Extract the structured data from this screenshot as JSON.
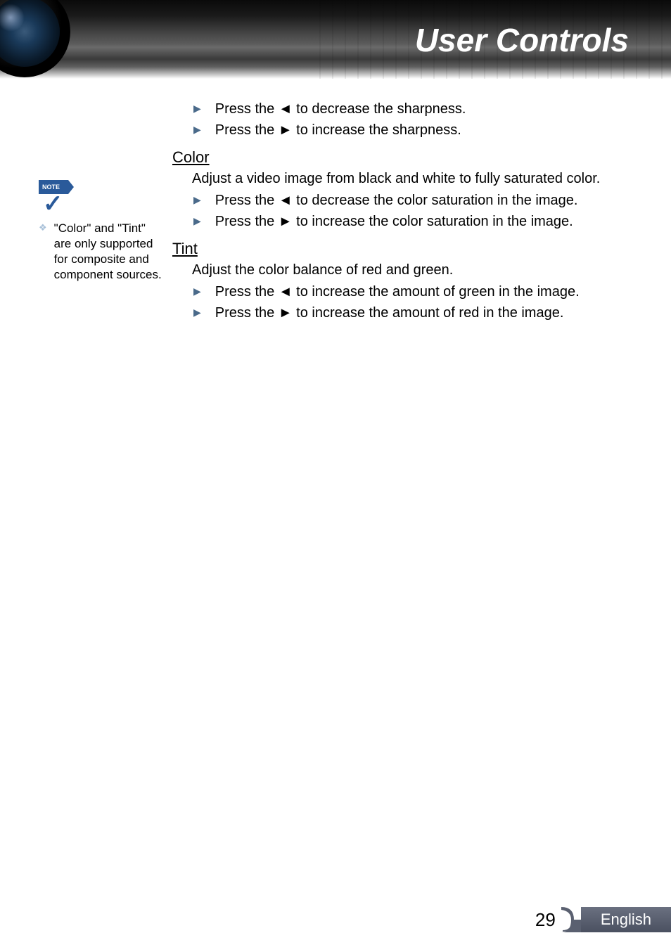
{
  "header": {
    "title": "User Controls"
  },
  "sharpness": {
    "items": [
      "Press the ◄ to decrease the sharpness.",
      "Press the ► to increase the sharpness."
    ]
  },
  "color": {
    "heading": "Color",
    "intro": "Adjust a video image from black and white to fully saturated color.",
    "items": [
      "Press the ◄ to decrease the color saturation in the image.",
      "Press the ► to increase the color saturation in the image."
    ]
  },
  "tint": {
    "heading": "Tint",
    "intro": "Adjust the color balance of red and green.",
    "items": [
      "Press the ◄ to increase the amount of green in the image.",
      "Press the ► to increase the amount of red in the image."
    ]
  },
  "note": {
    "label": "NOTE",
    "text": "\"Color\" and \"Tint\" are only supported for composite and component sources."
  },
  "footer": {
    "page": "29",
    "language": "English"
  }
}
